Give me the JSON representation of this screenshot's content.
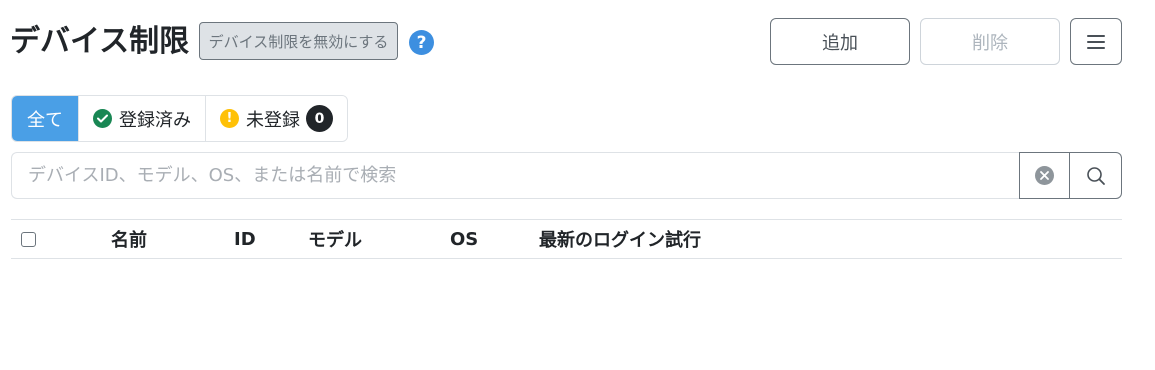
{
  "header": {
    "title": "デバイス制限",
    "disable_label": "デバイス制限を無効にする",
    "help_label": "?"
  },
  "toolbar": {
    "add_label": "追加",
    "delete_label": "削除",
    "menu_icon": "hamburger-menu-icon"
  },
  "filters": {
    "all_label": "全て",
    "registered_label": "登録済み",
    "unregistered_label": "未登録",
    "unregistered_count": "0",
    "selected": "全て"
  },
  "search": {
    "placeholder": "デバイスID、モデル、OS、または名前で検索",
    "value": ""
  },
  "table": {
    "columns": [
      "名前",
      "ID",
      "モデル",
      "OS",
      "最新のログイン試行"
    ]
  },
  "colors": {
    "accent": "#4a9fe6",
    "help": "#3d8fe0",
    "success": "#198754",
    "warning": "#ffc107",
    "badge": "#212529"
  }
}
